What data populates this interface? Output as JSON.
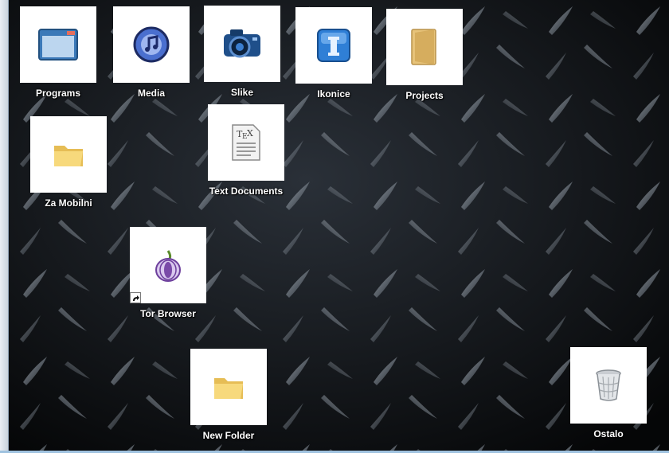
{
  "desktop": {
    "icons": [
      {
        "label": "Programs",
        "icon": "window-icon"
      },
      {
        "label": "Media",
        "icon": "itunes-icon"
      },
      {
        "label": "Slike",
        "icon": "camera-icon"
      },
      {
        "label": "Ikonice",
        "icon": "blue-i-icon"
      },
      {
        "label": "Projects",
        "icon": "folder-closed-icon"
      },
      {
        "label": "Za Mobilni",
        "icon": "folder-icon"
      },
      {
        "label": "Text Documents",
        "icon": "tex-document-icon"
      },
      {
        "label": "Tor Browser",
        "icon": "tor-onion-icon"
      },
      {
        "label": "New Folder",
        "icon": "folder-icon"
      },
      {
        "label": "Ostalo",
        "icon": "recycle-bin-icon"
      }
    ]
  },
  "colors": {
    "label_text": "#ffffff",
    "tile_bg": "#ffffff",
    "wallpaper": "#15191e"
  }
}
